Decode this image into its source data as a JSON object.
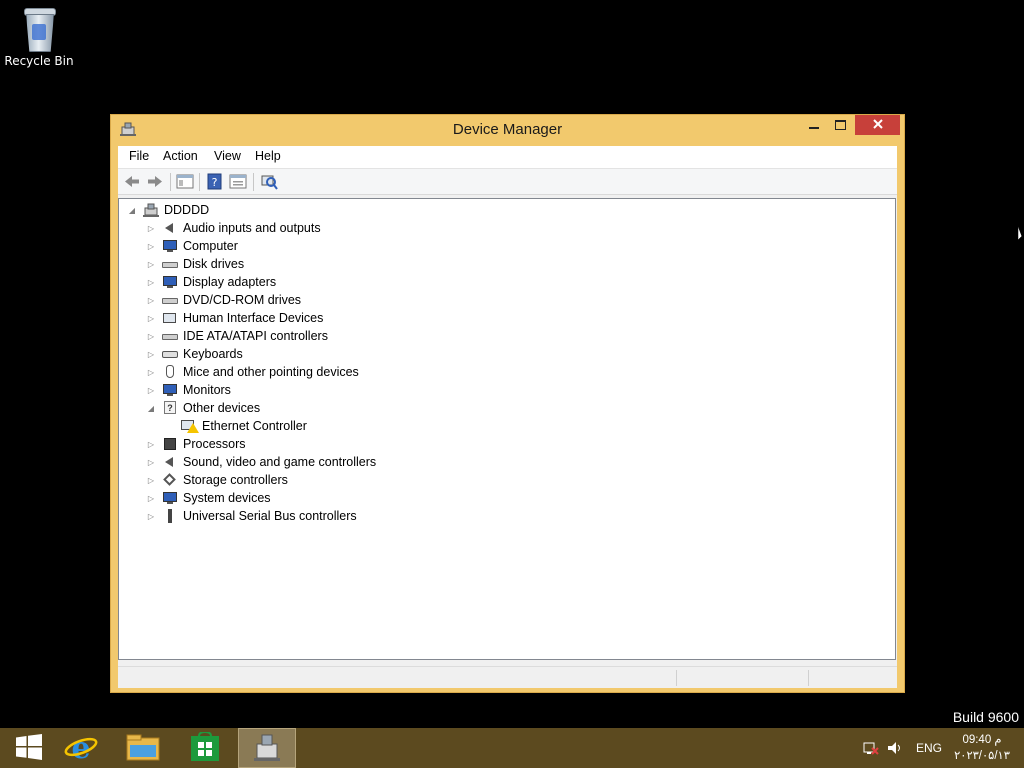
{
  "desktop": {
    "recycle_bin_label": "Recycle Bin",
    "build_text": "Build 9600"
  },
  "window": {
    "title": "Device Manager",
    "controls": {
      "minimize": "🗕",
      "maximize": "🗖",
      "close": "✕"
    },
    "menu": [
      "File",
      "Action",
      "View",
      "Help"
    ],
    "toolbar_icons": [
      "back-arrow-icon",
      "forward-arrow-icon",
      "show-hide-tree-icon",
      "help-icon",
      "properties-icon",
      "scan-hardware-icon"
    ]
  },
  "tree": {
    "root": "DDDDD",
    "categories": [
      {
        "label": "Audio inputs and outputs",
        "icon": "speaker-icon"
      },
      {
        "label": "Computer",
        "icon": "computer-icon"
      },
      {
        "label": "Disk drives",
        "icon": "disk-drive-icon"
      },
      {
        "label": "Display adapters",
        "icon": "display-adapter-icon"
      },
      {
        "label": "DVD/CD-ROM drives",
        "icon": "dvd-drive-icon"
      },
      {
        "label": "Human Interface Devices",
        "icon": "hid-icon"
      },
      {
        "label": "IDE ATA/ATAPI controllers",
        "icon": "ide-controller-icon"
      },
      {
        "label": "Keyboards",
        "icon": "keyboard-icon"
      },
      {
        "label": "Mice and other pointing devices",
        "icon": "mouse-icon"
      },
      {
        "label": "Monitors",
        "icon": "monitor-icon"
      },
      {
        "label": "Other devices",
        "icon": "unknown-device-icon",
        "expanded": true,
        "children": [
          {
            "label": "Ethernet Controller",
            "icon": "warning-device-icon"
          }
        ]
      },
      {
        "label": "Processors",
        "icon": "processor-icon"
      },
      {
        "label": "Sound, video and game controllers",
        "icon": "sound-controller-icon"
      },
      {
        "label": "Storage controllers",
        "icon": "storage-controller-icon"
      },
      {
        "label": "System devices",
        "icon": "system-devices-icon"
      },
      {
        "label": "Universal Serial Bus controllers",
        "icon": "usb-icon"
      }
    ]
  },
  "taskbar": {
    "apps": [
      "start-icon",
      "internet-explorer-icon",
      "file-explorer-icon",
      "store-icon",
      "device-manager-icon"
    ],
    "tray": {
      "language": "ENG",
      "time": "09:40 م",
      "date": "۲۰۲۳/۰۵/۱۳"
    }
  },
  "colors": {
    "window_frame": "#f2c96d",
    "close_button": "#c7403a",
    "taskbar": "#5c4a1f",
    "desktop": "#000000"
  }
}
